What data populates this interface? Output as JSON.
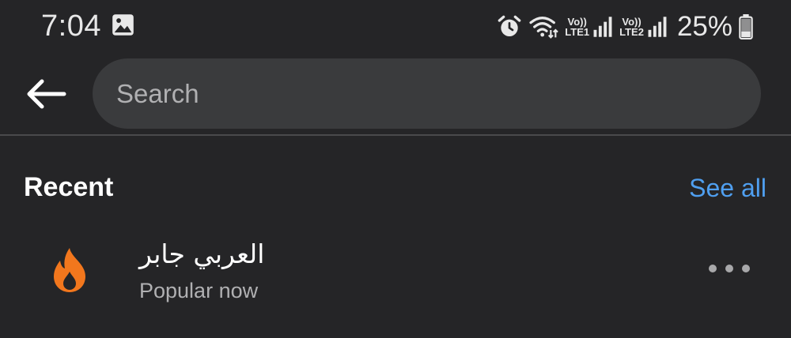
{
  "status_bar": {
    "time": "7:04",
    "sim1_top": "Vo))",
    "sim1_bottom": "LTE1",
    "sim2_top": "Vo))",
    "sim2_bottom": "LTE2",
    "battery": "25%",
    "icons": [
      "gallery-icon",
      "alarm-icon",
      "wifi-icon",
      "signal-icon",
      "signal-icon",
      "battery-icon"
    ]
  },
  "search": {
    "placeholder": "Search",
    "value": ""
  },
  "recent": {
    "heading": "Recent",
    "see_all": "See all",
    "items": [
      {
        "title": "العربي جابر",
        "subtitle": "Popular now",
        "icon": "fire-icon"
      }
    ]
  },
  "colors": {
    "background": "#252527",
    "search_field": "#3a3b3d",
    "link": "#4f9ff0",
    "trending": "#f2771d"
  }
}
